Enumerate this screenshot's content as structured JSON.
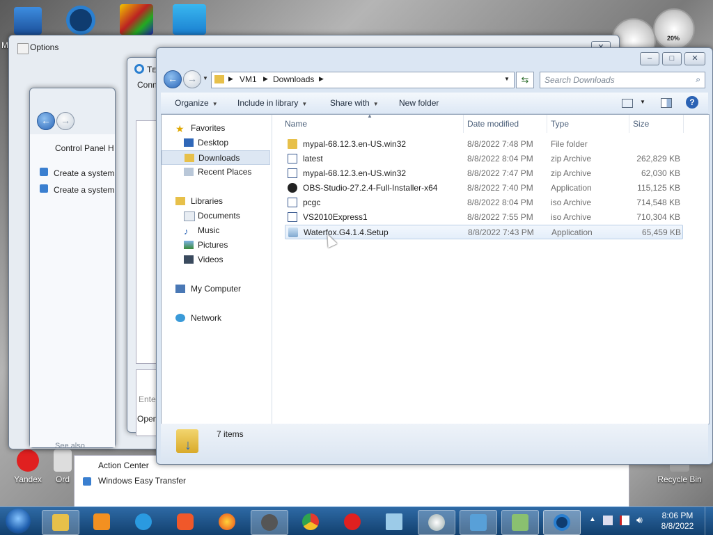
{
  "desktop": {
    "icons_top": [
      "",
      "",
      "",
      ""
    ],
    "yandex_label": "Yandex",
    "ord_label": "Ord",
    "recycle_bin_label": "Recycle Bin",
    "ma_label": "Ma",
    "gadget_percent": "20%"
  },
  "options_window": {
    "title": "Options",
    "back_title": "Tᴇ",
    "back_conn": "Conn",
    "back_enter": "Enter",
    "back_open": "Open"
  },
  "control_panel": {
    "title_text": "Control Panel H",
    "links": [
      "Create a system",
      "Create a system"
    ],
    "see_also": "See also"
  },
  "start_popup": {
    "items": [
      "Action Center",
      "Windows Easy Transfer"
    ]
  },
  "explorer": {
    "breadcrumb": [
      "VM1",
      "Downloads"
    ],
    "search_placeholder": "Search Downloads",
    "toolbar": {
      "organize": "Organize",
      "include_in_library": "Include in library",
      "share_with": "Share with",
      "new_folder": "New folder"
    },
    "nav": {
      "favorites": "Favorites",
      "desktop": "Desktop",
      "downloads": "Downloads",
      "recent_places": "Recent Places",
      "libraries": "Libraries",
      "documents": "Documents",
      "music": "Music",
      "pictures": "Pictures",
      "videos": "Videos",
      "my_computer": "My Computer",
      "network": "Network"
    },
    "columns": [
      "Name",
      "Date modified",
      "Type",
      "Size"
    ],
    "files": [
      {
        "name": "mypal-68.12.3.en-US.win32",
        "date": "8/8/2022 7:48 PM",
        "type": "File folder",
        "size": "",
        "icon": "folder-icon"
      },
      {
        "name": "latest",
        "date": "8/8/2022 8:04 PM",
        "type": "zip Archive",
        "size": "262,829 KB",
        "icon": "zip-icon"
      },
      {
        "name": "mypal-68.12.3.en-US.win32",
        "date": "8/8/2022 7:47 PM",
        "type": "zip Archive",
        "size": "62,030 KB",
        "icon": "zip-icon"
      },
      {
        "name": "OBS-Studio-27.2.4-Full-Installer-x64",
        "date": "8/8/2022 7:40 PM",
        "type": "Application",
        "size": "115,125 KB",
        "icon": "obs-icon"
      },
      {
        "name": "pcgc",
        "date": "8/8/2022 8:04 PM",
        "type": "iso Archive",
        "size": "714,548 KB",
        "icon": "iso-icon"
      },
      {
        "name": "VS2010Express1",
        "date": "8/8/2022 7:55 PM",
        "type": "iso Archive",
        "size": "710,304 KB",
        "icon": "iso-icon"
      },
      {
        "name": "Waterfox.G4.1.4.Setup",
        "date": "8/8/2022 7:43 PM",
        "type": "Application",
        "size": "65,459 KB",
        "icon": "installer-icon"
      }
    ],
    "status": "7 items"
  },
  "taskbar": {
    "time": "8:06 PM",
    "date": "8/8/2022"
  },
  "colors": {
    "taskbar": "#1c4f86",
    "explorer_frame": "#dbe6f3",
    "selection": "#e4eefa"
  }
}
